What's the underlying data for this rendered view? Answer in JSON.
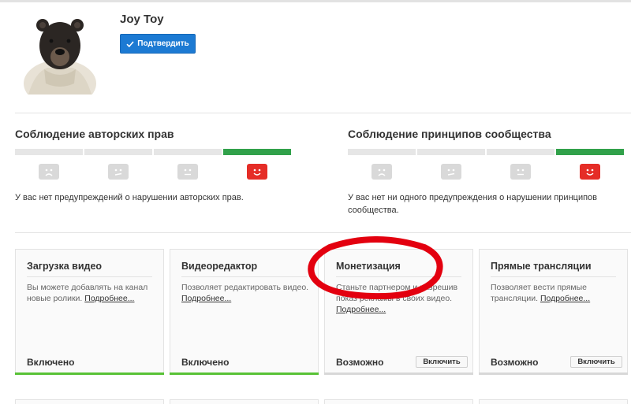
{
  "channel": {
    "name": "Joy Toy",
    "verify_label": "Подтвердить"
  },
  "copyright": {
    "title": "Соблюдение авторских прав",
    "message": "У вас нет предупреждений о нарушении авторских прав."
  },
  "community": {
    "title": "Соблюдение принципов сообщества",
    "message": "У вас нет ни одного предупреждения о нарушении принципов сообщества."
  },
  "features": [
    {
      "title": "Загрузка видео",
      "description": "Вы можете добавлять на канал новые ролики.",
      "more": "Подробнее...",
      "status": "Включено"
    },
    {
      "title": "Видеоредактор",
      "description": "Позволяет редактировать видео.",
      "more": "Подробнее...",
      "status": "Включено"
    },
    {
      "title": "Монетизация",
      "description": "Станьте партнером и разрешив показ рекламы в своих видео.",
      "more": "Подробнее...",
      "status": "Возможно",
      "button": "Включить"
    },
    {
      "title": "Прямые трансляции",
      "description": "Позволяет вести прямые трансляции.",
      "more": "Подробнее...",
      "status": "Возможно",
      "button": "Включить"
    }
  ],
  "colors": {
    "primary_button": "#1c7ad3",
    "strike_ok": "#31a14a",
    "youtube_red": "#e52d27",
    "enabled_bar": "#58c236",
    "annotation": "#e3000f"
  },
  "icons": {
    "avatar": "bear-photo",
    "verify": "checkmark-icon",
    "strike_faces": [
      "sad-face-icon",
      "frown-face-icon",
      "neutral-face-icon",
      "happy-youtube-icon"
    ]
  }
}
